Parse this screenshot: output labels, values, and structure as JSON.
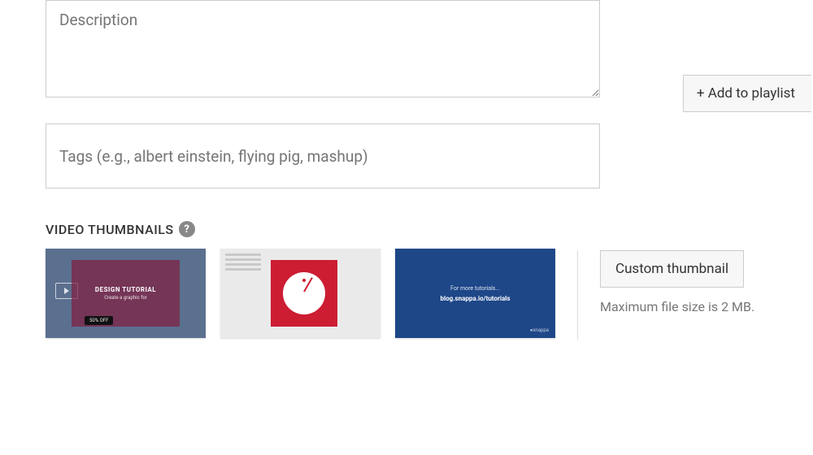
{
  "fields": {
    "description_placeholder": "Description",
    "tags_placeholder": "Tags (e.g., albert einstein, flying pig, mashup)"
  },
  "section": {
    "thumbnails_heading": "VIDEO THUMBNAILS"
  },
  "thumbnails": {
    "t1": {
      "title": "DESIGN TUTORIAL",
      "subtitle": "Create a graphic for",
      "badge": "50% OFF"
    },
    "t3": {
      "subtitle": "For more tutorials...",
      "main": "blog.snappa.io/tutorials",
      "brand": "snappa"
    }
  },
  "buttons": {
    "add_to_playlist": "+ Add to playlist",
    "custom_thumbnail": "Custom thumbnail"
  },
  "hints": {
    "max_file_size": "Maximum file size is 2 MB."
  }
}
